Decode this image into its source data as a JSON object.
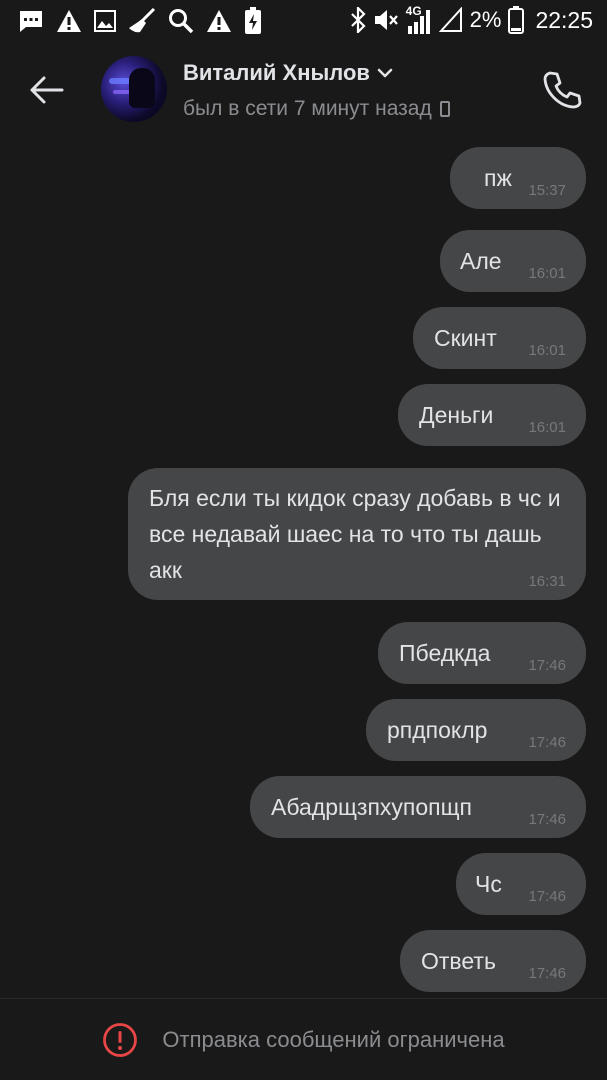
{
  "status_bar": {
    "battery_percent": "2%",
    "network": "4G",
    "time": "22:25",
    "icons": [
      "message-icon",
      "warning-icon",
      "image-icon",
      "broom-icon",
      "search-icon",
      "warning-icon",
      "battery-charging-icon",
      "bluetooth-icon",
      "mute-icon",
      "signal-icon",
      "signal-empty-icon",
      "battery-low-icon"
    ]
  },
  "header": {
    "contact_name": "Виталий Хнылов",
    "last_seen": "был в сети 7 минут назад"
  },
  "messages": [
    {
      "text": "пж",
      "time": "15:37"
    },
    {
      "text": "Але",
      "time": "16:01"
    },
    {
      "text": "Скинт",
      "time": "16:01"
    },
    {
      "text": "Деньги",
      "time": "16:01"
    },
    {
      "text": "Бля  если ты кидок сразу добавь в чс и все недавай шаес на то что ты дашь акк",
      "time": "16:31"
    },
    {
      "text": "Пбедкда",
      "time": "17:46"
    },
    {
      "text": "рпдпоклр",
      "time": "17:46"
    },
    {
      "text": "Абадрщзпхупопщп",
      "time": "17:46"
    },
    {
      "text": "Чс",
      "time": "17:46"
    },
    {
      "text": "Ответь",
      "time": "17:46"
    }
  ],
  "footer": {
    "notice": "Отправка сообщений ограничена"
  },
  "colors": {
    "background": "#19191a",
    "bubble": "#454647",
    "warning_red": "#e64646"
  }
}
